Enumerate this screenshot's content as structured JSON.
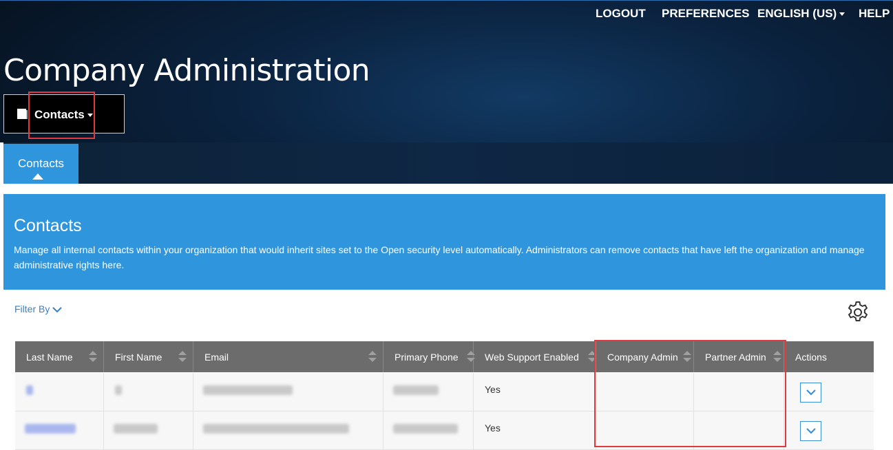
{
  "topnav": {
    "logout": "LOGOUT",
    "preferences": "PREFERENCES",
    "language": "ENGLISH (US)",
    "help": "HELP"
  },
  "header": {
    "title": "Company Administration",
    "module_select": {
      "label": "Contacts",
      "icon": "book-icon"
    }
  },
  "tabs": [
    {
      "label": "Contacts",
      "active": true
    }
  ],
  "banner": {
    "title": "Contacts",
    "description": "Manage all internal contacts within your organization that would inherit sites set to the Open security level automatically. Administrators can remove contacts that have left the organization and manage administrative rights here."
  },
  "filter": {
    "label": "Filter By"
  },
  "settings": {
    "icon": "gear-icon"
  },
  "table": {
    "columns": [
      "Last Name",
      "First Name",
      "Email",
      "Primary Phone",
      "Web Support Enabled",
      "Company Admin",
      "Partner Admin",
      "Actions"
    ],
    "rows": [
      {
        "web_support_enabled": "Yes",
        "company_admin": "",
        "partner_admin": ""
      },
      {
        "web_support_enabled": "Yes",
        "company_admin": "",
        "partner_admin": ""
      }
    ]
  },
  "colors": {
    "accent": "#2f95dc",
    "header_dark": "#0b2340",
    "table_header": "#6c6c6c",
    "highlight": "#e0393e"
  }
}
